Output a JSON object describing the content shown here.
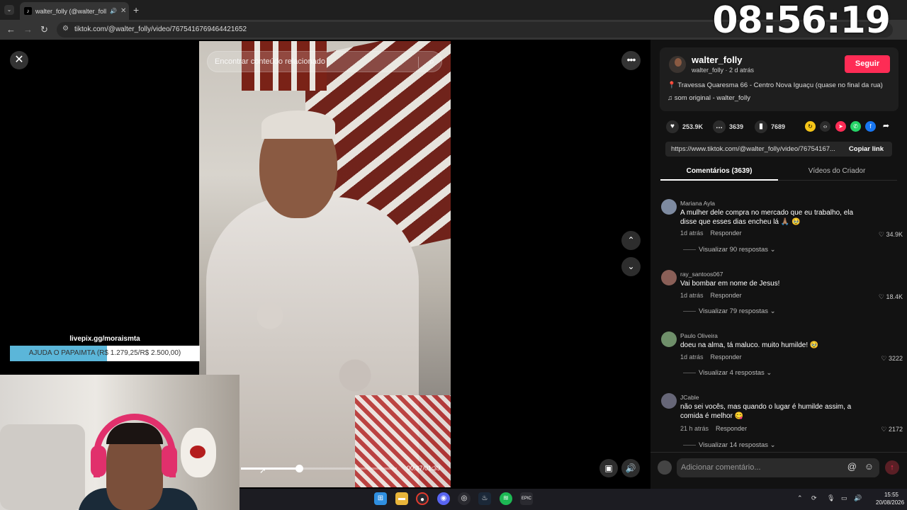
{
  "browser": {
    "tab_title": "walter_folly (@walter_folly) |",
    "url": "tiktok.com/@walter_folly/video/7675416769464421652"
  },
  "overlay_clock": "08:56:19",
  "search": {
    "placeholder": "Encontrar conteúdo relacionado"
  },
  "player": {
    "timecode": "00:37/01:39",
    "progress": 0.374
  },
  "livepix": {
    "label": "livepix.gg/moraismta",
    "text": "AJUDA O PAPAIMTA (R$ 1.279,25/R$ 2.500,00)",
    "progress": 0.512
  },
  "author": {
    "username": "walter_folly",
    "subline": "walter_folly · 2 d atrás",
    "follow_label": "Seguir",
    "location": "📍 Travessa Quaresma 66 - Centro Nova Iguaçu (quase no final da rua)",
    "sound": "♫  som original - walter_folly"
  },
  "stats": {
    "likes": "253.9K",
    "comments": "3639",
    "saves": "7689"
  },
  "link": {
    "url": "https://www.tiktok.com/@walter_folly/video/76754167...",
    "copy_label": "Copiar link"
  },
  "tabs": {
    "comments": "Comentários (3639)",
    "creator": "Vídeos do Criador"
  },
  "comments": [
    {
      "name": "Mariana Ayla",
      "text": "A mulher dele compra no mercado que eu trabalho, ela disse que esses dias encheu lá 🙏🏽 🥹",
      "time": "1d atrás",
      "reply": "Responder",
      "likes": "34.9K",
      "more": "Visualizar 90 respostas ⌄"
    },
    {
      "name": "ray_santoos067",
      "text": "Vai bombar em nome de Jesus!",
      "time": "1d atrás",
      "reply": "Responder",
      "likes": "18.4K",
      "more": "Visualizar 79 respostas ⌄"
    },
    {
      "name": "Paulo Oliveira",
      "text": "doeu na alma, tá maluco. muito humilde! 🥹",
      "time": "1d atrás",
      "reply": "Responder",
      "likes": "3222",
      "more": "Visualizar 4 respostas ⌄"
    },
    {
      "name": "JCable",
      "text": "não sei vocês, mas quando o lugar é humilde assim, a comida é melhor 😋",
      "time": "21 h atrás",
      "reply": "Responder",
      "likes": "2172",
      "more": "Visualizar 14 respostas ⌄"
    }
  ],
  "add_comment": {
    "placeholder": "Adicionar comentário..."
  },
  "taskbar": {
    "time": "15:55",
    "date": "20/08/2026"
  },
  "icons": {
    "close": "close-icon",
    "more": "more-icon",
    "search": "search-icon",
    "heart": "heart-icon",
    "comment": "comment-icon",
    "bookmark": "bookmark-icon"
  }
}
